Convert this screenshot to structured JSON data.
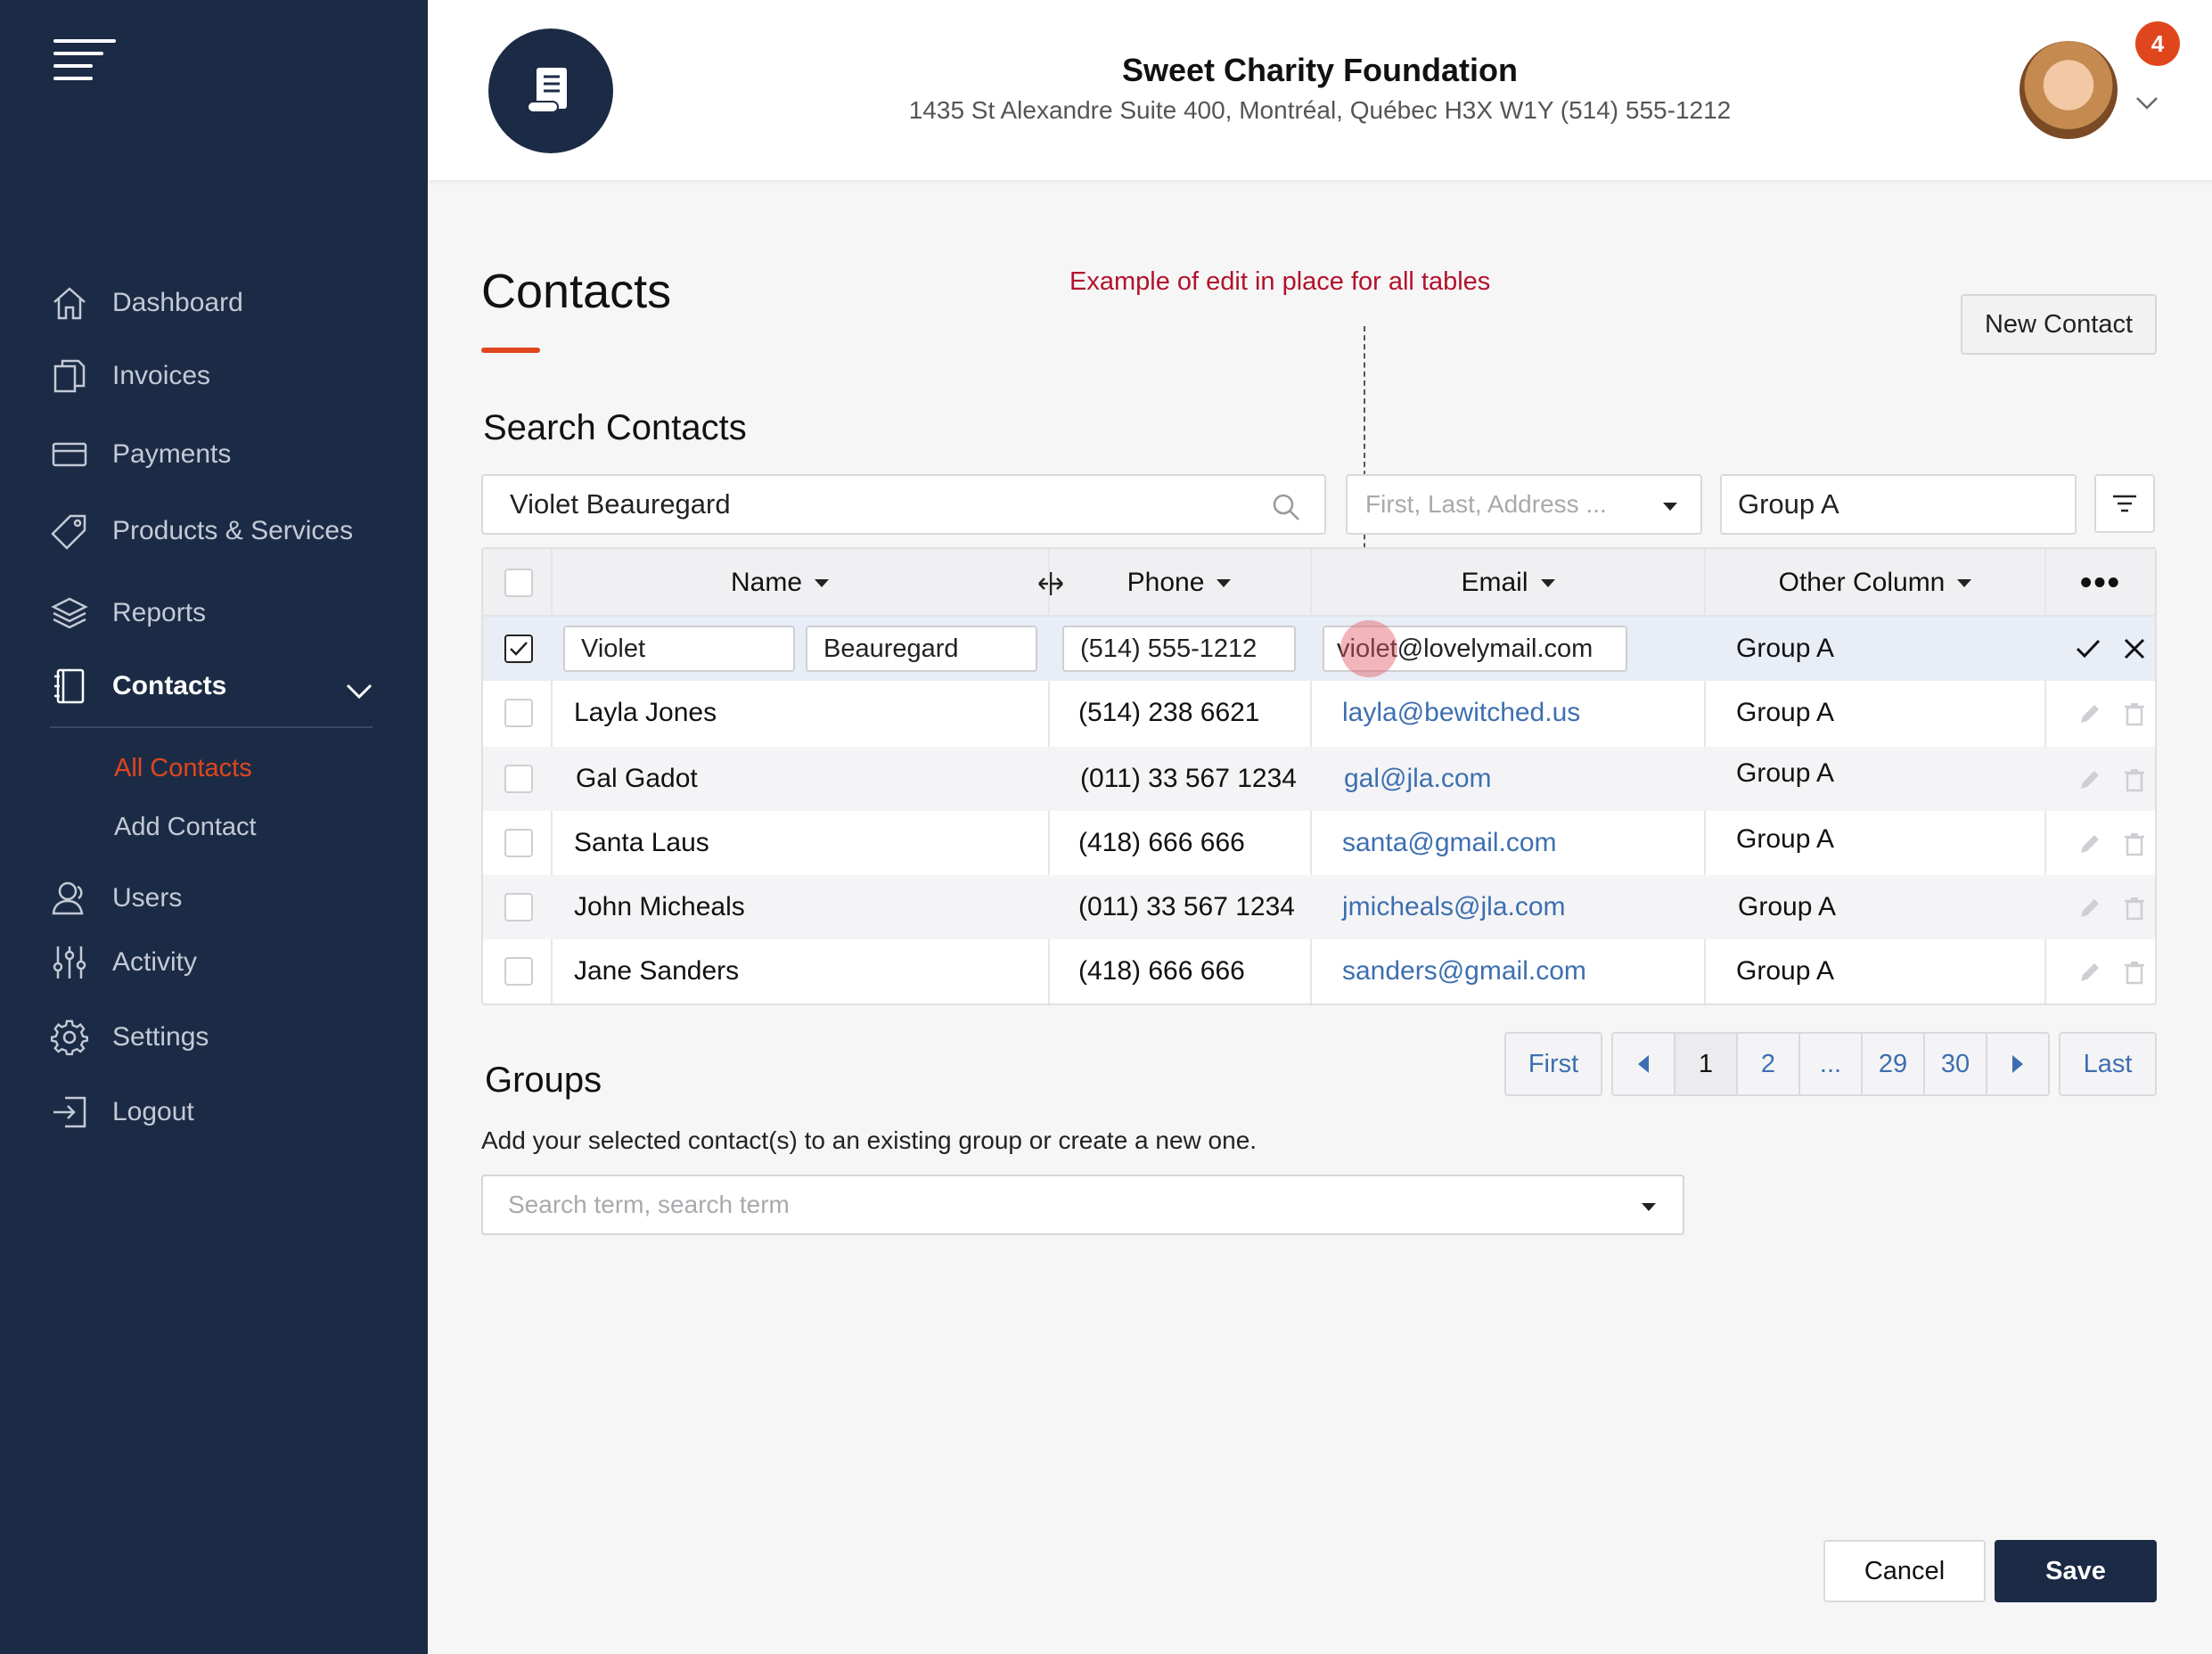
{
  "header": {
    "org_name": "Sweet Charity Foundation",
    "org_address": "1435 St Alexandre Suite 400, Montréal, Québec H3X W1Y (514) 555-1212",
    "notification_count": "4"
  },
  "sidebar": {
    "items": [
      {
        "label": "Dashboard",
        "icon": "home-icon"
      },
      {
        "label": "Invoices",
        "icon": "documents-icon"
      },
      {
        "label": "Payments",
        "icon": "credit-card-icon"
      },
      {
        "label": "Products & Services",
        "icon": "tag-icon"
      },
      {
        "label": "Reports",
        "icon": "layers-icon"
      },
      {
        "label": "Contacts",
        "icon": "address-book-icon"
      },
      {
        "label": "Users",
        "icon": "user-icon"
      },
      {
        "label": "Activity",
        "icon": "sliders-icon"
      },
      {
        "label": "Settings",
        "icon": "gear-icon"
      },
      {
        "label": "Logout",
        "icon": "logout-icon"
      }
    ],
    "sub_items": [
      {
        "label": "All Contacts"
      },
      {
        "label": "Add Contact"
      }
    ]
  },
  "main": {
    "title": "Contacts",
    "annotation": "Example of edit in place for all tables",
    "new_contact_label": "New Contact",
    "search_title": "Search Contacts",
    "search_value": "Violet Beauregard",
    "search_field_placeholder": "First, Last, Address ...",
    "group_filter_value": "Group A"
  },
  "table": {
    "headers": {
      "name": "Name",
      "phone": "Phone",
      "email": "Email",
      "other": "Other Column"
    },
    "edit_row": {
      "first": "Violet",
      "last": "Beauregard",
      "phone": "(514) 555-1212",
      "email": "violet@lovelymail.com",
      "group": "Group A"
    },
    "rows": [
      {
        "name": "Layla Jones",
        "phone": "(514) 238 6621",
        "email": "layla@bewitched.us",
        "group": "Group A"
      },
      {
        "name": "Gal Gadot",
        "phone": "(011) 33 567 1234",
        "email": "gal@jla.com",
        "group": "Group A"
      },
      {
        "name": "Santa Laus",
        "phone": "(418) 666 666",
        "email": "santa@gmail.com",
        "group": "Group A"
      },
      {
        "name": "John Micheals",
        "phone": "(011) 33 567 1234",
        "email": "jmicheals@jla.com",
        "group": "Group A"
      },
      {
        "name": "Jane Sanders",
        "phone": "(418) 666 666",
        "email": "sanders@gmail.com",
        "group": "Group A"
      }
    ]
  },
  "pagination": {
    "first": "First",
    "pages": [
      "1",
      "2",
      "...",
      "29",
      "30"
    ],
    "current": "1",
    "last": "Last"
  },
  "groups": {
    "title": "Groups",
    "description": "Add your selected contact(s) to an existing group or create a new one.",
    "placeholder": "Search term, search term"
  },
  "footer": {
    "cancel_label": "Cancel",
    "save_label": "Save"
  },
  "colors": {
    "sidebar_bg": "#1c2b45",
    "accent": "#e0461c",
    "link": "#3d6fb0",
    "annotation": "#b3122b"
  }
}
